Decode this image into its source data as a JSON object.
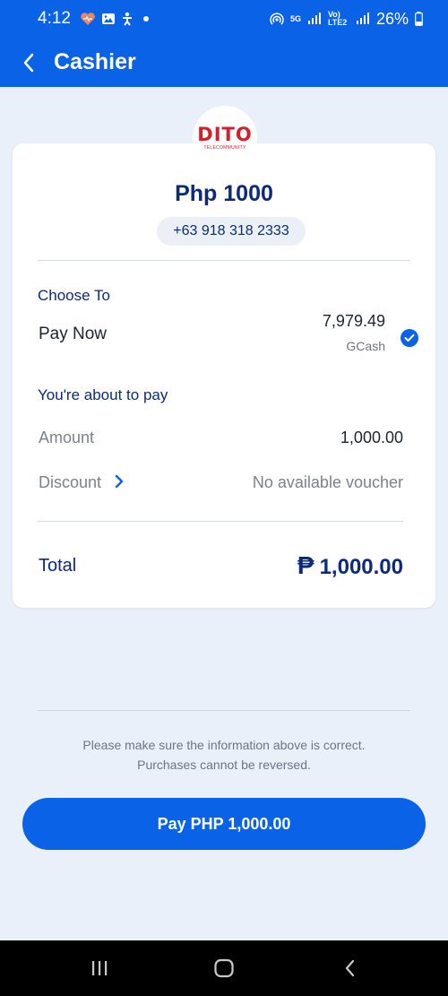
{
  "status_bar": {
    "time": "4:12",
    "network_tag": "5G",
    "volte_tag": "Vo) LTE2",
    "battery": "26%"
  },
  "header": {
    "title": "Cashier"
  },
  "merchant": {
    "logo_word": "DITO",
    "logo_sub": "TELECOMMUNITY"
  },
  "summary": {
    "amount": "Php 1000",
    "phone": "+63 918 318 2333"
  },
  "payment": {
    "choose_label": "Choose To",
    "option_label": "Pay Now",
    "balance": "7,979.49",
    "method": "GCash",
    "selected": true
  },
  "breakdown": {
    "section_label": "You're about to pay",
    "amount_label": "Amount",
    "amount_value": "1,000.00",
    "discount_label": "Discount",
    "discount_value": "No available voucher",
    "total_label": "Total",
    "currency_symbol": "₱",
    "total_value": "1,000.00"
  },
  "notice": {
    "line1": "Please make sure the information above is correct.",
    "line2": "Purchases cannot be reversed."
  },
  "pay_button_label": "Pay PHP 1,000.00",
  "colors": {
    "brand_blue": "#0a63e7",
    "navy_text": "#0d2a78",
    "logo_red": "#d0202b",
    "page_bg": "#eaf0f9"
  },
  "icons": {
    "back": "chevron-left-icon",
    "selected": "check-circle-icon",
    "discount": "chevron-right-icon",
    "nav_recents": "recents-icon",
    "nav_home": "home-icon",
    "nav_back": "back-icon"
  }
}
